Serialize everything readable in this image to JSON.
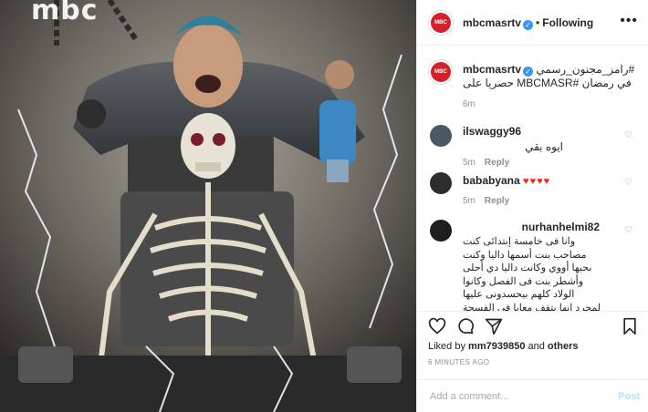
{
  "media": {
    "brand_text": "mbc",
    "description_icon": "poster-image"
  },
  "header": {
    "username": "mbcmasrtv",
    "separator": "•",
    "follow_state": "Following",
    "more_icon": "•••",
    "avatar_text": "MBC MASR"
  },
  "caption": {
    "username": "mbcmasrtv",
    "text": "#رامز_مجنون_رسمي في رمضان #MBCMASR حصريا على",
    "age": "6m"
  },
  "comments": [
    {
      "username": "ilswaggy96",
      "text": "ايوه بقي",
      "age": "5m",
      "reply": "Reply"
    },
    {
      "username": "bababyana",
      "text": "♥♥♥♥",
      "age": "5m",
      "reply": "Reply"
    },
    {
      "username": "nurhanhelmi82",
      "text": "وانا فى خامسة إبتدائى كنت مصاحب بنت أسمها داليا وكنت بحبها أووي وكانت داليا دي أحلى وأشطر بنت فى الفصل وكانوا الولاد كلهم بيحسدونى عليها لمجرد انها بتقف معايا فى الفسحة وبتروح معايا بعد ما نخلص ومرة",
      "age": "",
      "reply": ""
    }
  ],
  "actions": {
    "like_icon": "heart-outline",
    "comment_icon": "speech-bubble",
    "share_icon": "paper-plane",
    "save_icon": "bookmark"
  },
  "likes": {
    "prefix": "Liked by",
    "user": "mm7939850",
    "connector": "and",
    "others": "others"
  },
  "timestamp": "6 MINUTES AGO",
  "add_comment": {
    "placeholder": "Add a comment...",
    "post_label": "Post"
  },
  "colors": {
    "accent_blue": "#3897f0",
    "brand_red": "#d4202a",
    "heart_red": "#ed2b2b",
    "post_disabled": "#b2dffc"
  }
}
